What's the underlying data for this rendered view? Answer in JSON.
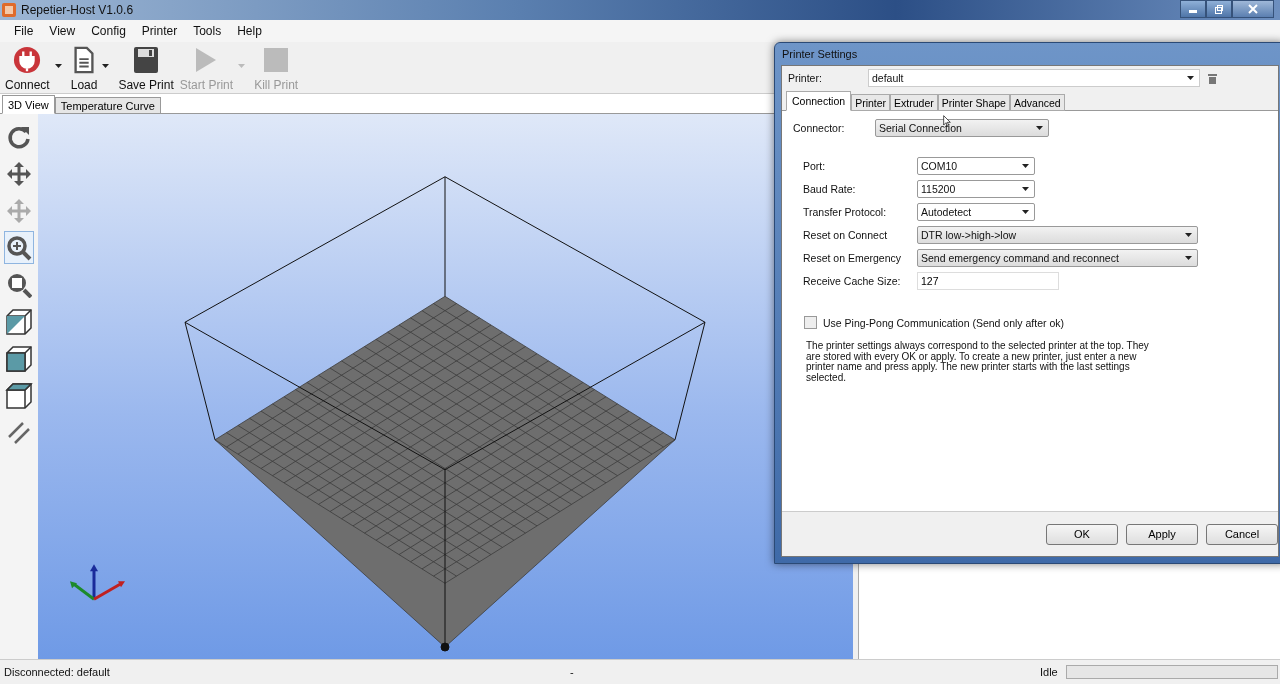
{
  "window": {
    "title": "Repetier-Host V1.0.6"
  },
  "menu": [
    "File",
    "View",
    "Config",
    "Printer",
    "Tools",
    "Help"
  ],
  "toolbar": [
    {
      "kind": "connect",
      "label": "Connect",
      "disabled": false,
      "dropdown": true
    },
    {
      "kind": "load",
      "label": "Load",
      "disabled": false,
      "dropdown": true
    },
    {
      "kind": "save",
      "label": "Save Print",
      "disabled": false,
      "dropdown": false
    },
    {
      "kind": "start",
      "label": "Start Print",
      "disabled": true,
      "dropdown": true
    },
    {
      "kind": "kill",
      "label": "Kill Print",
      "disabled": true,
      "dropdown": false
    }
  ],
  "view_tabs": [
    {
      "label": "3D View",
      "selected": true
    },
    {
      "label": "Temperature Curve",
      "selected": false
    }
  ],
  "view_tools": [
    {
      "kind": "rotate",
      "selected": false
    },
    {
      "kind": "move",
      "selected": false
    },
    {
      "kind": "move-object",
      "selected": false
    },
    {
      "kind": "zoom",
      "selected": true
    },
    {
      "kind": "fit",
      "selected": false
    },
    {
      "kind": "cube-iso",
      "selected": false
    },
    {
      "kind": "cube-front",
      "selected": false
    },
    {
      "kind": "cube-top",
      "selected": false
    },
    {
      "kind": "parallel",
      "selected": false
    }
  ],
  "dialog": {
    "title": "Printer Settings",
    "printer": {
      "label": "Printer:",
      "value": "default"
    },
    "tabs": [
      {
        "label": "Connection",
        "selected": true
      },
      {
        "label": "Printer",
        "selected": false
      },
      {
        "label": "Extruder",
        "selected": false
      },
      {
        "label": "Printer Shape",
        "selected": false
      },
      {
        "label": "Advanced",
        "selected": false
      }
    ],
    "connector": {
      "label": "Connector:",
      "value": "Serial Connection"
    },
    "fields": [
      {
        "label": "Port:",
        "value": "COM10",
        "kind": "short-select"
      },
      {
        "label": "Baud Rate:",
        "value": "115200",
        "kind": "short-select"
      },
      {
        "label": "Transfer Protocol:",
        "value": "Autodetect",
        "kind": "short-select"
      },
      {
        "label": "Reset on Connect",
        "value": "DTR low->high->low",
        "kind": "long-select"
      },
      {
        "label": "Reset on Emergency",
        "value": "Send emergency command and reconnect",
        "kind": "long-select"
      },
      {
        "label": "Receive Cache Size:",
        "value": "127",
        "kind": "text-input"
      }
    ],
    "ping_pong": {
      "label": "Use Ping-Pong Communication (Send only after ok)",
      "checked": false
    },
    "note": "The printer settings always correspond to the selected printer at the top. They are stored with every OK or apply. To create a new printer, just enter a new printer name and press apply. The new printer starts with the last settings selected.",
    "buttons": [
      "OK",
      "Apply",
      "Cancel"
    ]
  },
  "status_bar": {
    "connection": "Disconnected: default",
    "middle": "-",
    "state": "Idle",
    "level": 0
  }
}
